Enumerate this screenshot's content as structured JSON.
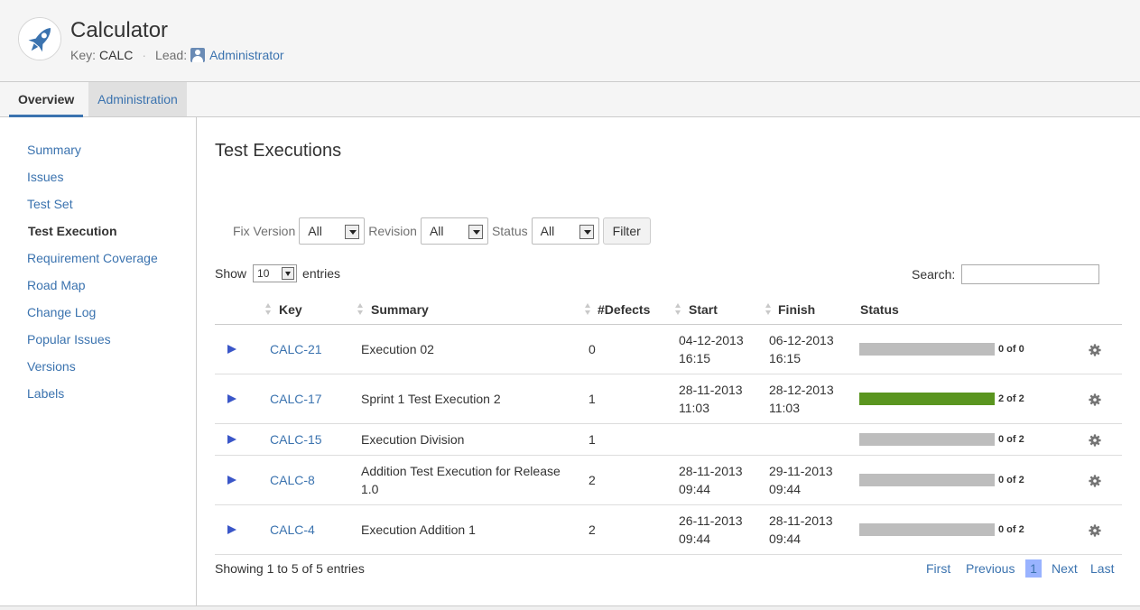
{
  "project": {
    "title": "Calculator",
    "key_label": "Key:",
    "key_value": "CALC",
    "lead_label": "Lead:",
    "lead_value": "Administrator"
  },
  "tabs": {
    "overview": "Overview",
    "administration": "Administration"
  },
  "sidebar": {
    "items": [
      {
        "label": "Summary"
      },
      {
        "label": "Issues"
      },
      {
        "label": "Test Set"
      },
      {
        "label": "Test Execution",
        "active": true
      },
      {
        "label": "Requirement Coverage"
      },
      {
        "label": "Road Map"
      },
      {
        "label": "Change Log"
      },
      {
        "label": "Popular Issues"
      },
      {
        "label": "Versions"
      },
      {
        "label": "Labels"
      }
    ]
  },
  "main": {
    "title": "Test Executions",
    "filters": {
      "fix_version_label": "Fix Version",
      "fix_version_value": "All",
      "revision_label": "Revision",
      "revision_value": "All",
      "status_label": "Status",
      "status_value": "All",
      "filter_button": "Filter"
    },
    "length": {
      "show_label": "Show",
      "value": "10",
      "entries_label": "entries"
    },
    "search": {
      "label": "Search:",
      "value": ""
    },
    "table": {
      "columns": [
        "Key",
        "Summary",
        "#Defects",
        "Start",
        "Finish",
        "Status"
      ],
      "rows": [
        {
          "key": "CALC-21",
          "summary_lines": [
            "Execution 02"
          ],
          "defects": "0",
          "start": [
            "04-12-2013",
            "16:15"
          ],
          "finish": [
            "06-12-2013",
            "16:15"
          ],
          "passed": 0,
          "total": 0,
          "status_text": "0 of 0"
        },
        {
          "key": "CALC-17",
          "summary_lines": [
            "Sprint 1 Test Execution 2"
          ],
          "defects": "1",
          "start": [
            "28-11-2013",
            "11:03"
          ],
          "finish": [
            "28-12-2013",
            "11:03"
          ],
          "passed": 2,
          "total": 2,
          "status_text": "2 of 2"
        },
        {
          "key": "CALC-15",
          "summary_lines": [
            "Execution Division"
          ],
          "defects": "1",
          "start": [],
          "finish": [],
          "passed": 0,
          "total": 2,
          "status_text": "0 of 2"
        },
        {
          "key": "CALC-8",
          "summary_lines": [
            "Addition Test Execution for Release",
            "1.0"
          ],
          "defects": "2",
          "start": [
            "28-11-2013",
            "09:44"
          ],
          "finish": [
            "29-11-2013",
            "09:44"
          ],
          "passed": 0,
          "total": 2,
          "status_text": "0 of 2"
        },
        {
          "key": "CALC-4",
          "summary_lines": [
            "Execution Addition 1"
          ],
          "defects": "2",
          "start": [
            "26-11-2013",
            "09:44"
          ],
          "finish": [
            "28-11-2013",
            "09:44"
          ],
          "passed": 0,
          "total": 2,
          "status_text": "0 of 2"
        }
      ]
    },
    "info": {
      "showing": "Showing",
      "from": "1",
      "to_label": "to",
      "to": "5",
      "of_label": "of",
      "total": "5",
      "entries": "entries"
    },
    "pager": {
      "first": "First",
      "previous": "Previous",
      "current": "1",
      "next": "Next",
      "last": "Last"
    }
  },
  "colors": {
    "link": "#3b73af",
    "progress_pass": "#5a951f",
    "progress_empty": "#bdbdbd",
    "play_icon": "#3a56c8",
    "pager_current": "#99b3ff"
  },
  "icons": {
    "project_avatar": "rocket-icon",
    "lead": "user-icon",
    "row_expand": "play-icon",
    "row_actions": "gear-icon"
  }
}
